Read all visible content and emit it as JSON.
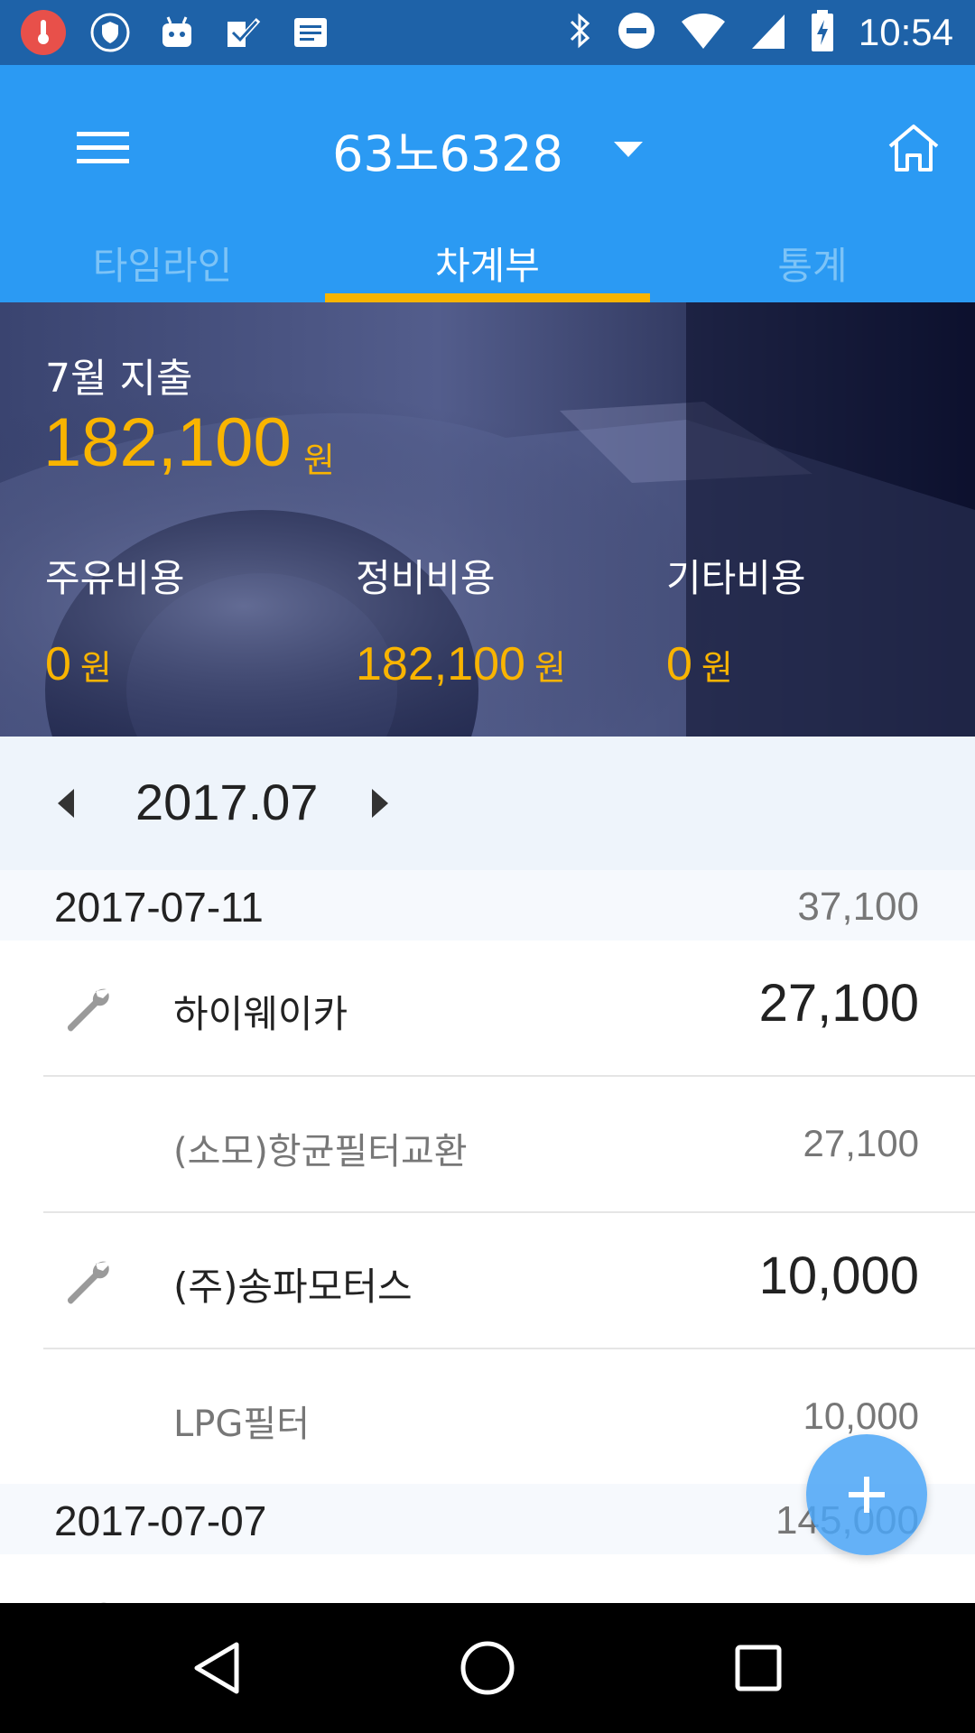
{
  "status_bar": {
    "time": "10:54",
    "left_icons": [
      "thermometer-icon",
      "shield-icon",
      "android-icon",
      "check-icon",
      "message-icon"
    ],
    "right_icons": [
      "bluetooth-icon",
      "dnd-icon",
      "wifi-icon",
      "signal-icon",
      "battery-charging-icon"
    ]
  },
  "app_bar": {
    "car_title": "63노6328",
    "tabs": [
      {
        "label": "타임라인",
        "active": false
      },
      {
        "label": "차계부",
        "active": true
      },
      {
        "label": "통계",
        "active": false
      }
    ]
  },
  "summary": {
    "month_label": "7월 지출",
    "total": "182,100",
    "unit": "원",
    "categories": [
      {
        "label": "주유비용",
        "value": "0",
        "unit": "원"
      },
      {
        "label": "정비비용",
        "value": "182,100",
        "unit": "원"
      },
      {
        "label": "기타비용",
        "value": "0",
        "unit": "원"
      }
    ]
  },
  "month_selector": {
    "value": "2017.07"
  },
  "list": {
    "day1": {
      "date": "2017-07-11",
      "total": "37,100"
    },
    "shop1": {
      "name": "하이웨이카",
      "amount": "27,100",
      "icon": "wrench-icon"
    },
    "item1": {
      "name": "(소모)항균필터교환",
      "amount": "27,100"
    },
    "shop2": {
      "name": "(주)송파모터스",
      "amount": "10,000",
      "icon": "wrench-icon"
    },
    "item2": {
      "name": "LPG필터",
      "amount": "10,000"
    },
    "day2": {
      "date": "2017-07-07",
      "total": "145,000"
    }
  },
  "colors": {
    "status_bar": "#1e62a8",
    "app_bar": "#2b9af3",
    "accent": "#f9b400",
    "fab": "#4aa4f6"
  }
}
